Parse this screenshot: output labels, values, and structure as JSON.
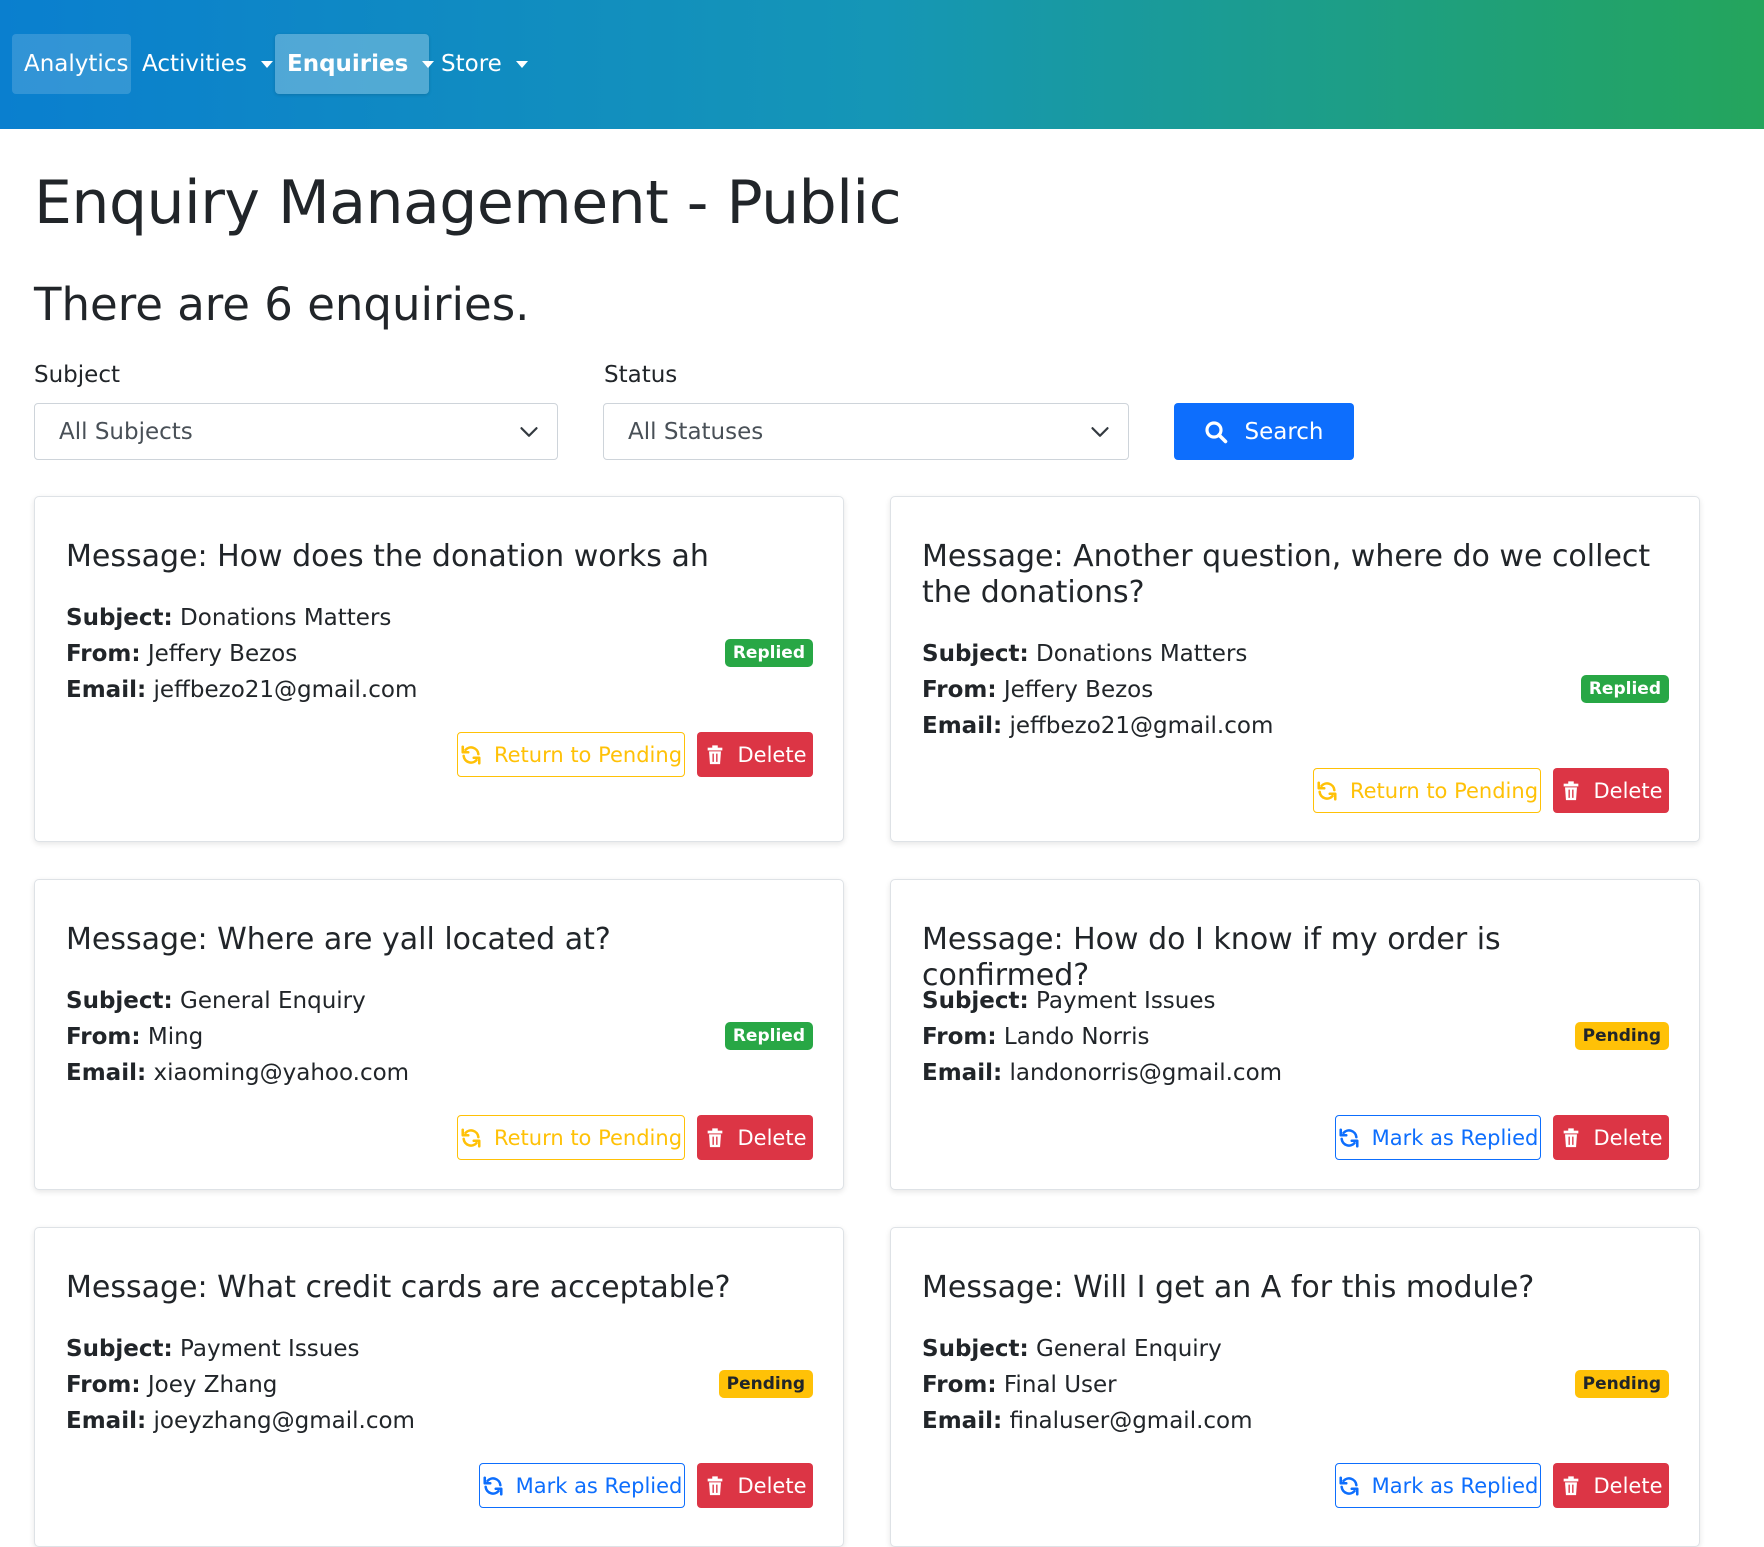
{
  "nav": {
    "items": [
      {
        "label": "Analytics"
      },
      {
        "label": "Activities"
      },
      {
        "label": "Enquiries"
      },
      {
        "label": "Store"
      }
    ]
  },
  "page": {
    "title": "Enquiry Management - Public",
    "count_text": "There are 6 enquiries."
  },
  "filters": {
    "subject_label": "Subject",
    "subject_value": "All Subjects",
    "status_label": "Status",
    "status_value": "All Statuses",
    "search_label": "Search"
  },
  "labels": {
    "subject": "Subject:",
    "from": "From:",
    "email": "Email:",
    "return_to_pending": "Return to Pending",
    "mark_as_replied": "Mark as Replied",
    "delete": "Delete"
  },
  "colors": {
    "primary": "#0d6efd",
    "replied": "#28a745",
    "pending": "#ffc107",
    "danger": "#dc3545"
  },
  "enquiries": [
    {
      "message": "Message: How does the donation works ah",
      "subject": "Donations Matters",
      "from": "Jeffery Bezos",
      "email": "jeffbezo21@gmail.com",
      "status": "Replied"
    },
    {
      "message": "Message: Another question, where do we collect the donations?",
      "subject": "Donations Matters",
      "from": "Jeffery Bezos",
      "email": "jeffbezo21@gmail.com",
      "status": "Replied"
    },
    {
      "message": "Message: Where are yall located at?",
      "subject": "General Enquiry",
      "from": "Ming",
      "email": "xiaoming@yahoo.com",
      "status": "Replied"
    },
    {
      "message": "Message: How do I know if my order is confirmed?",
      "subject": "Payment Issues",
      "from": "Lando Norris",
      "email": "landonorris@gmail.com",
      "status": "Pending"
    },
    {
      "message": "Message: What credit cards are acceptable?",
      "subject": "Payment Issues",
      "from": "Joey Zhang",
      "email": "joeyzhang@gmail.com",
      "status": "Pending"
    },
    {
      "message": "Message: Will I get an A for this module?",
      "subject": "General Enquiry",
      "from": "Final User",
      "email": "finaluser@gmail.com",
      "status": "Pending"
    }
  ]
}
